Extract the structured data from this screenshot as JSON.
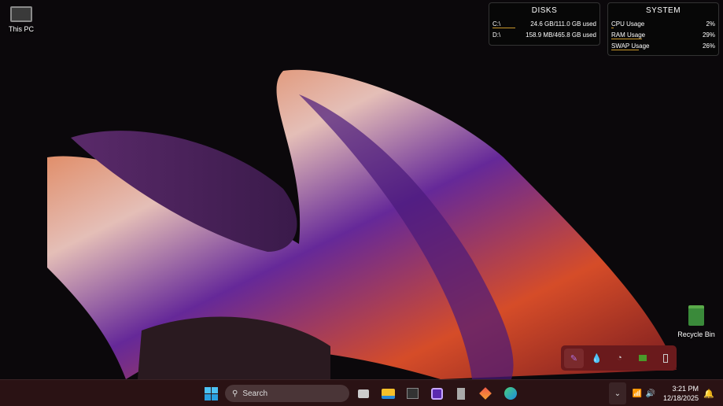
{
  "desktop": {
    "icons": [
      {
        "label": "This PC",
        "icon": "monitor-icon"
      },
      {
        "label": "Recycle Bin",
        "icon": "recycle-bin-icon"
      }
    ]
  },
  "disks": {
    "title": "DISKS",
    "rows": [
      {
        "name": "C:\\",
        "value": "24.6 GB/111.0 GB used",
        "fraction": 0.22
      },
      {
        "name": "D:\\",
        "value": "158.9 MB/465.8 GB used",
        "fraction": 0.0003
      }
    ]
  },
  "system": {
    "title": "SYSTEM",
    "rows": [
      {
        "name": "CPU Usage",
        "value": "2%",
        "fraction": 0.02
      },
      {
        "name": "RAM Usage",
        "value": "29%",
        "fraction": 0.29
      },
      {
        "name": "SWAP Usage",
        "value": "26%",
        "fraction": 0.26
      }
    ]
  },
  "taskbar": {
    "search_placeholder": "Search",
    "apps": [
      "start-icon",
      "task-view-icon",
      "file-explorer-icon",
      "capture-app-icon",
      "chip-app-icon",
      "devices-app-icon",
      "cube-app-icon",
      "edge-icon"
    ]
  },
  "tray": {
    "hidden_icons": [
      "feather-icon",
      "drop-icon",
      "network-mon-icon",
      "nvidia-icon",
      "usb-icon"
    ],
    "time": "3:21 PM",
    "date": "12/18/2025"
  },
  "colors": {
    "accent": "#c8962a",
    "taskbar": "#2a1214"
  }
}
